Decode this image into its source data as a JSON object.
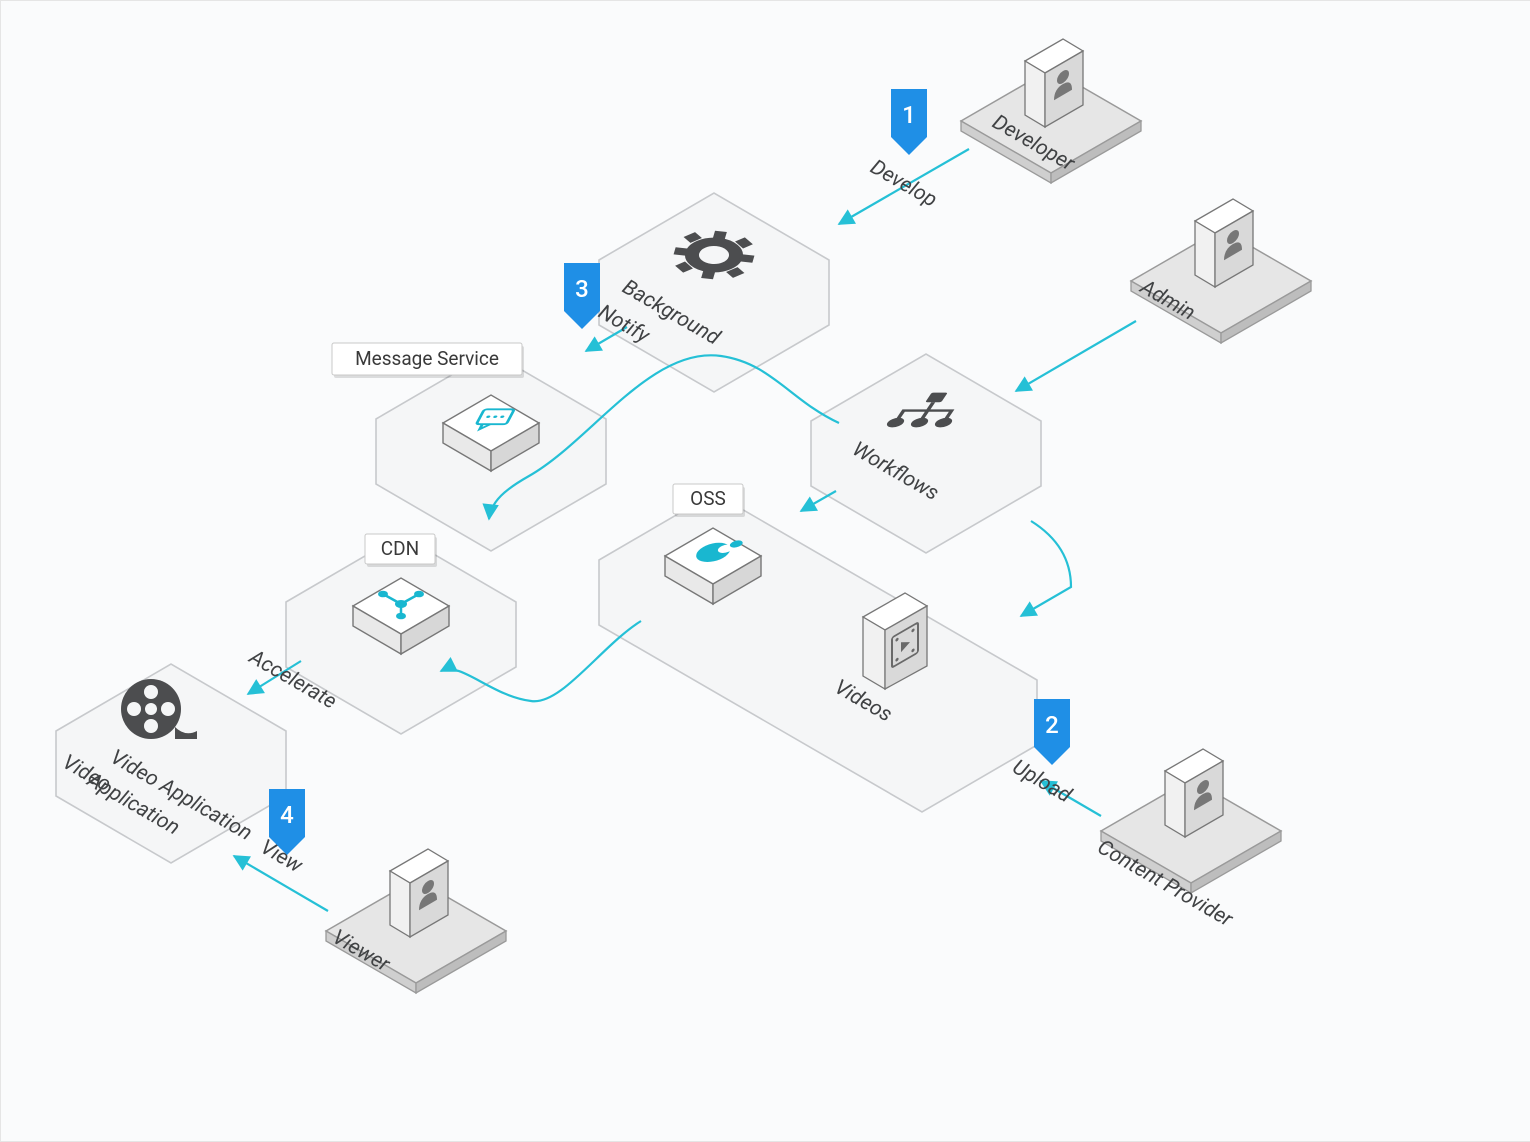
{
  "actors": {
    "developer": "Developer",
    "admin": "Admin",
    "content_provider": "Content Provider",
    "viewer": "Viewer"
  },
  "nodes": {
    "background": "Background",
    "workflows": "Workflows",
    "message_service": "Message Service",
    "cdn": "CDN",
    "oss": "OSS",
    "videos": "Videos",
    "video_application": "Video Application"
  },
  "edges": {
    "develop": "Develop",
    "notify": "Notify",
    "upload": "Upload",
    "accelerate": "Accelerate",
    "view": "View"
  },
  "steps": {
    "s1": "1",
    "s2": "2",
    "s3": "3",
    "s4": "4"
  },
  "colors": {
    "accent": "#1f8fe6",
    "flow": "#25c0d6",
    "hex_fill": "#f5f6f7",
    "hex_stroke": "#c7c9cc"
  }
}
